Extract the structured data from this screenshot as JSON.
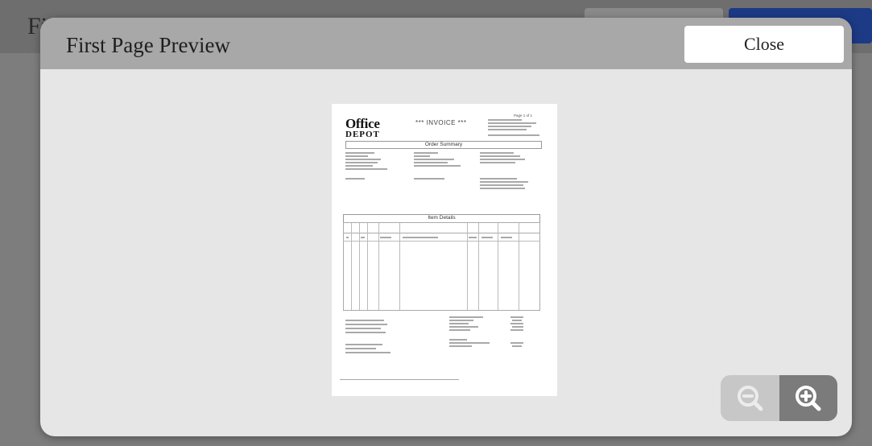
{
  "background": {
    "title_fragment": "Fi"
  },
  "modal": {
    "title": "First Page Preview",
    "close_label": "Close"
  },
  "preview": {
    "logo_line1": "Office",
    "logo_line2": "DEPOT",
    "invoice_title": "*** INVOICE ***",
    "page_label": "Page 1 of 1",
    "order_summary": "Order Summary",
    "item_details": "Item Details"
  },
  "zoom": {
    "zoom_out_icon": "zoom-out-icon",
    "zoom_in_icon": "zoom-in-icon"
  },
  "colors": {
    "modal_header": "#a8a8a8",
    "modal_body": "#e6e6e6",
    "zoom_out_bg": "#c7c7c7",
    "zoom_in_bg": "#7b7b7b",
    "bg_primary_button": "#1d3a86"
  }
}
